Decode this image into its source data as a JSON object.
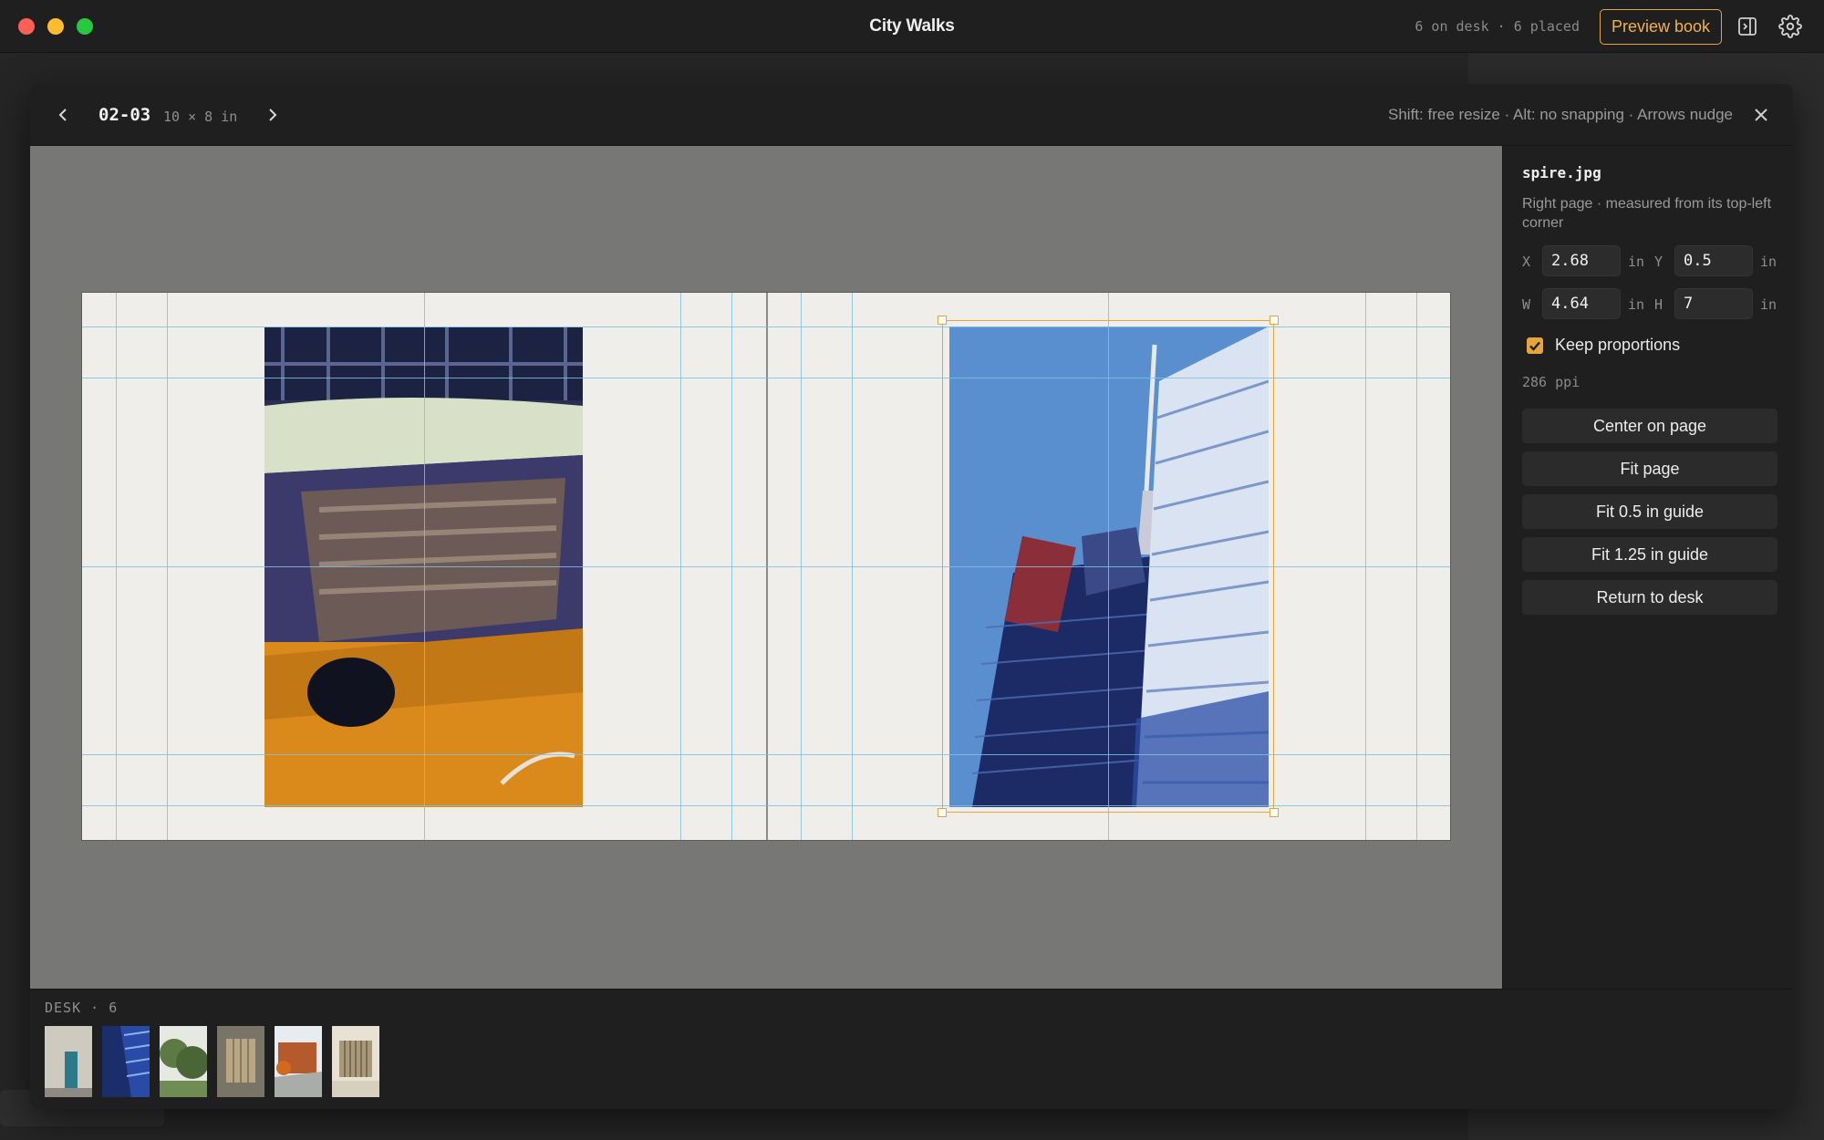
{
  "app": {
    "title": "City Walks",
    "status": "6 on desk · 6 placed",
    "preview_label": "Preview book",
    "accent_color": "#e3a53c"
  },
  "editor": {
    "spread_id": "02-03",
    "spread_size": "10 × 8 in",
    "hints": "Shift: free resize · Alt: no snapping · Arrows nudge"
  },
  "inspector": {
    "filename": "spire.jpg",
    "description": "Right page · measured from its top-left corner",
    "fields": {
      "x": {
        "label": "X",
        "value": "2.68",
        "unit": "in"
      },
      "y": {
        "label": "Y",
        "value": "0.5",
        "unit": "in"
      },
      "w": {
        "label": "W",
        "value": "4.64",
        "unit": "in"
      },
      "h": {
        "label": "H",
        "value": "7",
        "unit": "in"
      }
    },
    "keep_proportions_label": "Keep proportions",
    "keep_proportions": true,
    "ppi": "286 ppi",
    "actions": [
      "Center on page",
      "Fit page",
      "Fit 0.5 in guide",
      "Fit 1.25 in guide",
      "Return to desk"
    ]
  },
  "desk": {
    "label": "DESK · 6",
    "thumbnails": [
      "door",
      "blue-tower",
      "trees",
      "gate",
      "brick-building",
      "facade"
    ]
  },
  "icons": {
    "prev": "chevron-left-icon",
    "next": "chevron-right-icon",
    "close": "close-icon",
    "panel": "sidebar-toggle-icon",
    "settings": "gear-icon"
  }
}
